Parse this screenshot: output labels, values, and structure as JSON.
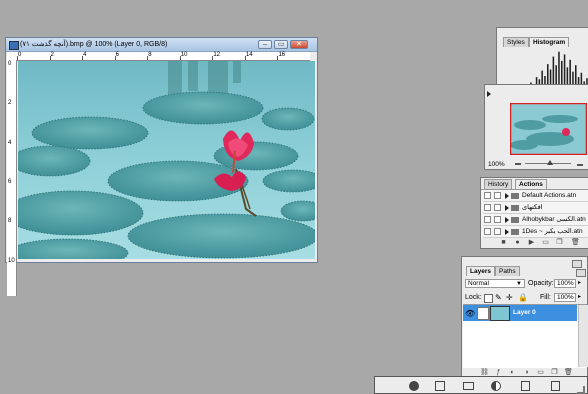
{
  "document_window": {
    "title": "(آنچه گذشت ۷۱).bmp @ 100% (Layer 0, RGB/8)",
    "controls": {
      "minimize": "–",
      "restore": "▭",
      "close": "✕"
    },
    "ruler_top": [
      "0",
      "2",
      "4",
      "6",
      "8",
      "10",
      "12",
      "14",
      "16"
    ],
    "ruler_left": [
      "0",
      "2",
      "4",
      "6",
      "8",
      "10"
    ]
  },
  "histogram_panel": {
    "tabs": [
      "Styles",
      "Histogram"
    ],
    "active_tab": "Histogram",
    "bars": [
      0.08,
      0.12,
      0.1,
      0.18,
      0.14,
      0.22,
      0.2,
      0.3,
      0.26,
      0.38,
      0.34,
      0.48,
      0.44,
      0.6,
      0.5,
      0.72,
      0.62,
      0.86,
      0.7,
      0.95,
      0.78,
      0.9,
      0.66,
      0.8,
      0.58,
      0.7,
      0.48,
      0.56,
      0.4,
      0.46
    ]
  },
  "navigator_panel": {
    "zoom": "100%"
  },
  "actions_panel": {
    "tabs": [
      "History",
      "Actions"
    ],
    "active_tab": "Actions",
    "items": [
      "Default Actions.atn",
      "افکتهای",
      "Alhobykbar الکسی.atn",
      "1Des ~ الحب بکبر.atn"
    ]
  },
  "layers_panel": {
    "tabs": [
      "Layers",
      "Paths"
    ],
    "active_tab": "Layers",
    "blend_mode": "Normal",
    "opacity_label": "Opacity:",
    "opacity_value": "100%",
    "lock_label": "Lock:",
    "fill_label": "Fill:",
    "fill_value": "100%",
    "layer_name": "Layer 0"
  },
  "colors": {
    "desktop": "#a8a8a8",
    "selection": "#3d8fe0",
    "flower": "#e0285a",
    "water": "#7ec6d2"
  }
}
